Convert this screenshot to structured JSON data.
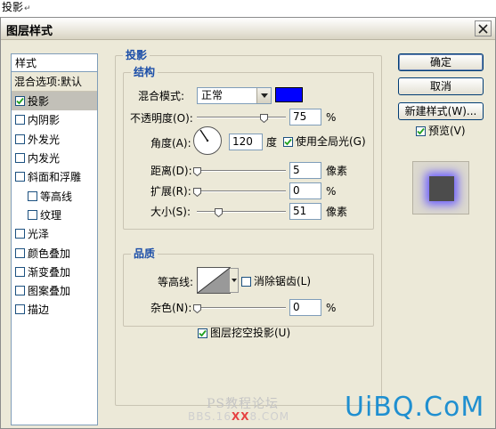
{
  "doc_title": "投影",
  "doc_return_mark": "↵",
  "dialog": {
    "title": "图层样式",
    "close_icon": "close-x-icon"
  },
  "style_list": {
    "header": "样式",
    "blend_options": "混合选项:默认",
    "items": [
      {
        "label": "投影",
        "checked": true,
        "selected": true
      },
      {
        "label": "内阴影",
        "checked": false
      },
      {
        "label": "外发光",
        "checked": false
      },
      {
        "label": "内发光",
        "checked": false
      },
      {
        "label": "斜面和浮雕",
        "checked": false
      },
      {
        "label": "等高线",
        "checked": false,
        "sub": true
      },
      {
        "label": "纹理",
        "checked": false,
        "sub": true
      },
      {
        "label": "光泽",
        "checked": false
      },
      {
        "label": "颜色叠加",
        "checked": false
      },
      {
        "label": "渐变叠加",
        "checked": false
      },
      {
        "label": "图案叠加",
        "checked": false
      },
      {
        "label": "描边",
        "checked": false
      }
    ]
  },
  "drop_shadow": {
    "section_title": "投影",
    "structure": {
      "title": "结构",
      "blend_mode_label": "混合模式:",
      "blend_mode_value": "正常",
      "shadow_color": "#0000ff",
      "opacity_label": "不透明度(O):",
      "opacity_value": "75",
      "opacity_unit": "%",
      "opacity_fraction": 0.75,
      "angle_label": "角度(A):",
      "angle_value": "120",
      "angle_unit": "度",
      "global_light_label": "使用全局光(G)",
      "global_light_checked": true,
      "distance_label": "距离(D):",
      "distance_value": "5",
      "distance_unit": "像素",
      "spread_label": "扩展(R):",
      "spread_value": "0",
      "spread_unit": "%",
      "size_label": "大小(S):",
      "size_value": "51",
      "size_unit": "像素"
    },
    "quality": {
      "title": "品质",
      "contour_label": "等高线:",
      "antialias_label": "消除锯齿(L)",
      "antialias_checked": false,
      "noise_label": "杂色(N):",
      "noise_value": "0",
      "noise_unit": "%"
    },
    "knockout_label": "图层挖空投影(U)",
    "knockout_checked": true
  },
  "buttons": {
    "ok": "确定",
    "cancel": "取消",
    "new_style": "新建样式(W)...",
    "preview_label": "预览(V)",
    "preview_checked": true
  },
  "watermarks": {
    "forum": "PS教程论坛",
    "site_prefix": "BBS.16",
    "site_red": "XX",
    "site_suffix": "8.COM",
    "brand": "UiBQ.CoM"
  }
}
